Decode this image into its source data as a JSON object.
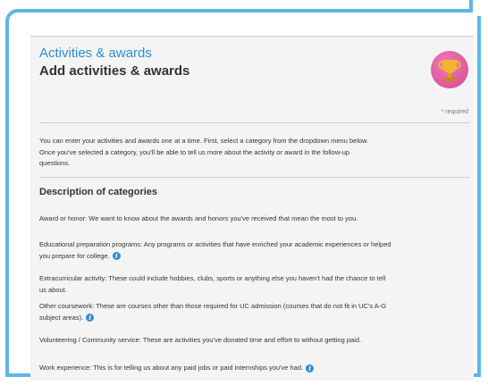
{
  "header": {
    "section": "Activities & awards",
    "title": "Add activities & awards",
    "required_note": "* required"
  },
  "intro": "You can enter your activities and awards one at a time. First, select a category from the dropdown menu below. Once you've selected a category, you'll be able to tell us more about the activity or award in the follow-up questions.",
  "description_title": "Description of categories",
  "categories": [
    {
      "text": "Award or honor: We want to know about the awards and honors you've received that mean the most to you.",
      "info": false
    },
    {
      "text": "Educational preparation programs: Any programs or activities that have enriched your academic experiences or helped you prepare for college.",
      "info": true
    },
    {
      "text": "Extracurricular activity: These could include hobbies, clubs, sports or anything else you haven't had the chance to tell us about.",
      "info": false
    },
    {
      "text": "Other coursework: These are courses other than those required for UC admission (courses that do not fit in UC's A-G subject areas).",
      "info": true
    },
    {
      "text": "Volunteering / Community service: These are activities you've donated time and effort to without getting paid.",
      "info": false
    },
    {
      "text": "Work experience: This is for telling us about any paid jobs or paid internships you've had.",
      "info": true
    }
  ],
  "icons": {
    "trophy": "trophy-icon",
    "info": "info-icon"
  },
  "colors": {
    "frame": "#5bb8e6",
    "accent": "#2d8fd0",
    "trophy_bg": "#e0579b",
    "trophy_cup": "#f2b533"
  }
}
